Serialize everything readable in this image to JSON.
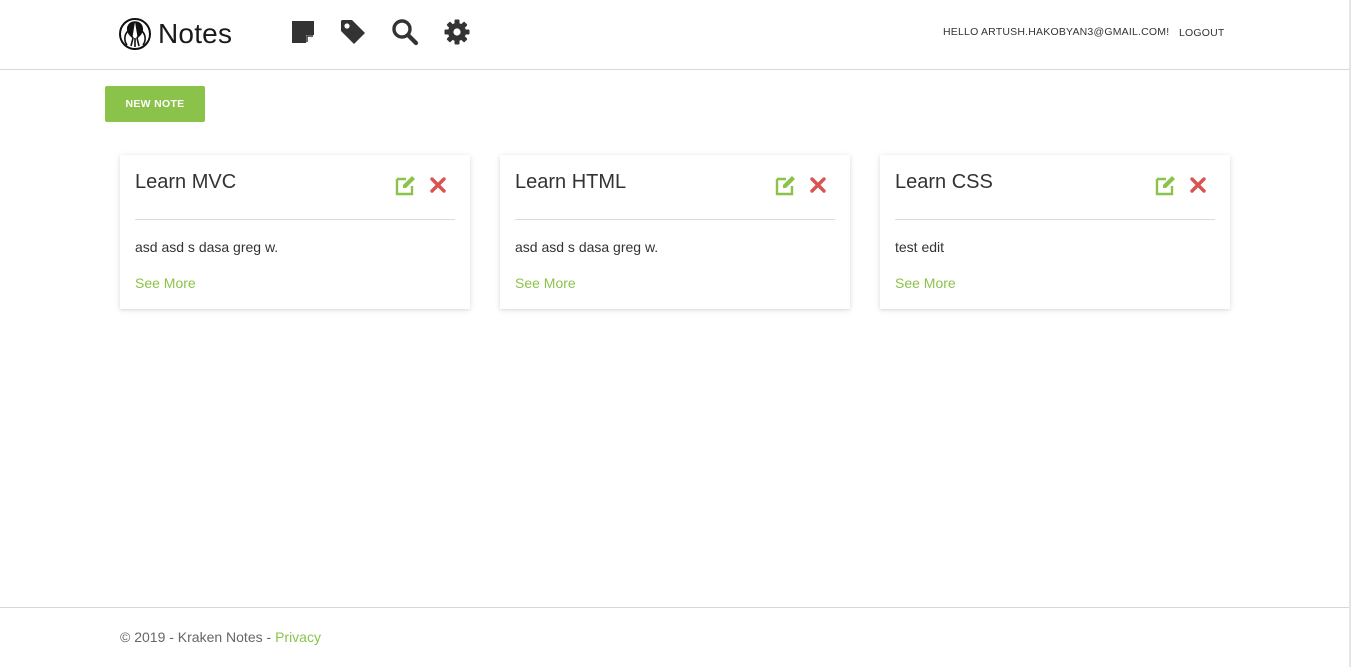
{
  "app": {
    "brand": "Notes"
  },
  "nav": {
    "icons": [
      "notes-icon",
      "tag-icon",
      "search-icon",
      "gear-icon"
    ],
    "greeting": "HELLO ARTUSH.HAKOBYAN3@GMAIL.COM!",
    "logout_label": "LOGOUT"
  },
  "toolbar": {
    "new_note_label": "NEW NOTE"
  },
  "notes": [
    {
      "title": "Learn MVC",
      "body": "asd asd s dasa greg w.",
      "link": "See More"
    },
    {
      "title": "Learn HTML",
      "body": "asd asd s dasa greg w.",
      "link": "See More"
    },
    {
      "title": "Learn CSS",
      "body": "test edit",
      "link": "See More"
    }
  ],
  "footer": {
    "copyright": "© 2019 - Kraken Notes - ",
    "privacy_label": "Privacy"
  },
  "colors": {
    "accent": "#8bc34a",
    "delete": "#d9534f",
    "icon": "#333333"
  }
}
